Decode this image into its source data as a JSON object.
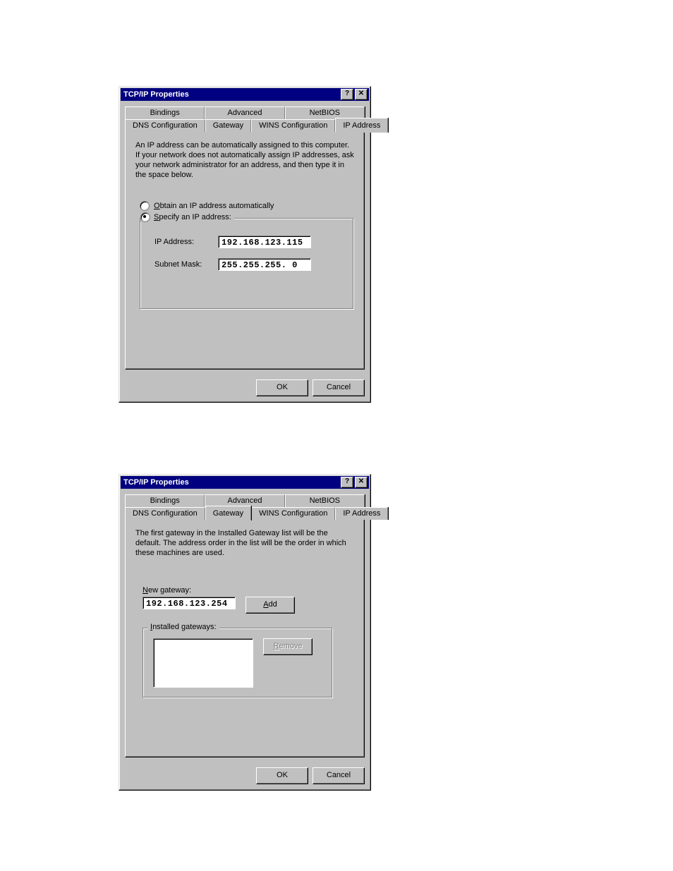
{
  "dialog1": {
    "title": "TCP/IP Properties",
    "tabs_row1": [
      "Bindings",
      "Advanced",
      "NetBIOS"
    ],
    "tabs_row2": [
      "DNS Configuration",
      "Gateway",
      "WINS Configuration",
      "IP Address"
    ],
    "active_tab": "IP Address",
    "description": "An IP address can be automatically assigned to this computer. If your network does not automatically assign IP addresses, ask your network administrator for an address, and then type it in the space below.",
    "radio_obtain": "Obtain an IP address automatically",
    "radio_specify": "Specify an IP address:",
    "ip_label": "IP Address:",
    "ip_value": "192.168.123.115",
    "mask_label": "Subnet Mask:",
    "mask_value": "255.255.255.  0",
    "ok": "OK",
    "cancel": "Cancel"
  },
  "dialog2": {
    "title": "TCP/IP Properties",
    "tabs_row1": [
      "Bindings",
      "Advanced",
      "NetBIOS"
    ],
    "tabs_row2": [
      "DNS Configuration",
      "Gateway",
      "WINS Configuration",
      "IP Address"
    ],
    "active_tab": "Gateway",
    "description": "The first gateway in the Installed Gateway list will be the default. The address order in the list will be the order in which these machines are used.",
    "new_gw_label": "New gateway:",
    "new_gw_value": "192.168.123.254",
    "add_btn": "Add",
    "installed_label": "Installed gateways:",
    "remove_btn": "Remove",
    "ok": "OK",
    "cancel": "Cancel"
  }
}
